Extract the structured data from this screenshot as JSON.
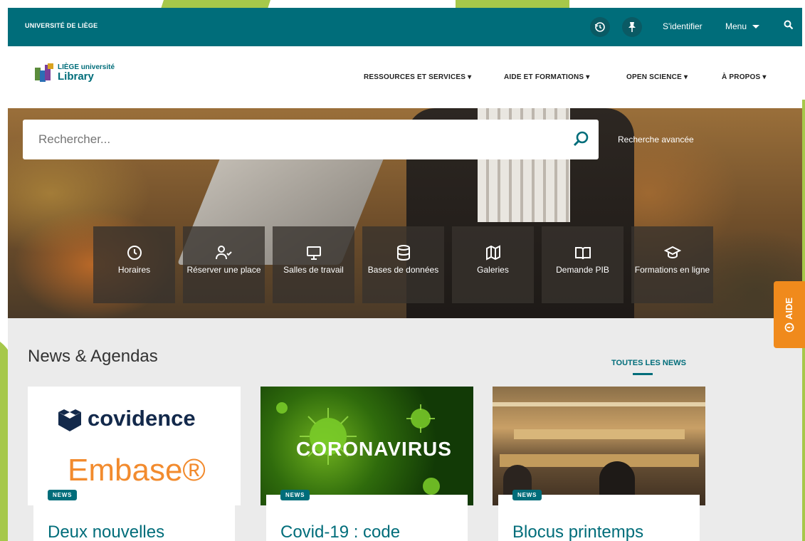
{
  "topbar": {
    "university": "UNIVERSITÉ DE LIÈGE",
    "login": "S'identifier",
    "menu": "Menu"
  },
  "brand": {
    "line1": "LIÈGE université",
    "line2": "Library"
  },
  "nav": [
    {
      "label": "RESSOURCES ET SERVICES"
    },
    {
      "label": "AIDE ET FORMATIONS"
    },
    {
      "label": "OPEN SCIENCE"
    },
    {
      "label": "À PROPOS"
    }
  ],
  "search": {
    "placeholder": "Rechercher...",
    "advanced": "Recherche avancée"
  },
  "tiles": [
    {
      "label": "Horaires",
      "icon": "clock-icon"
    },
    {
      "label": "Réserver une place",
      "icon": "user-check-icon"
    },
    {
      "label": "Salles de travail",
      "icon": "monitor-icon"
    },
    {
      "label": "Bases de données",
      "icon": "database-icon"
    },
    {
      "label": "Galeries",
      "icon": "map-icon"
    },
    {
      "label": "Demande PIB",
      "icon": "book-open-icon"
    },
    {
      "label": "Formations en ligne",
      "icon": "graduation-cap-icon"
    }
  ],
  "help_tab": "AIDE",
  "news": {
    "title": "News & Agendas",
    "all_link": "TOUTES LES NEWS",
    "cards": [
      {
        "tag": "NEWS",
        "title": "Deux nouvelles",
        "img_text1": "covidence",
        "img_text2": "Embase®"
      },
      {
        "tag": "NEWS",
        "title": "Covid-19 : code",
        "img_text1": "CORONAVIRUS"
      },
      {
        "tag": "NEWS",
        "title": "Blocus printemps"
      }
    ]
  },
  "colors": {
    "primary": "#006d7a",
    "accent_orange": "#f08a1c",
    "accent_green": "#a6c84a"
  }
}
